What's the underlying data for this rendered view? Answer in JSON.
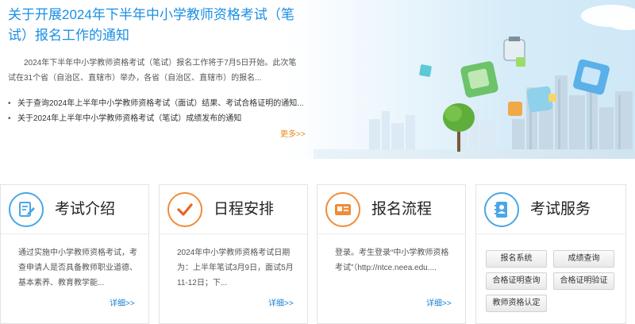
{
  "news": {
    "title": "关于开展2024年下半年中小学教师资格考试（笔试）报名工作的通知",
    "summary": "2024年下半年中小学教师资格考试（笔试）报名工作将于7月5日开始。此次笔试在31个省（自治区、直辖市）举办，各省（自治区、直辖市）的报名...",
    "items": [
      "关于查询2024年上半年中小学教师资格考试（面试）结果、考试合格证明的通知...",
      "关于2024年上半年中小学教师资格考试（笔试）成绩发布的通知"
    ],
    "bullet": "•",
    "more_label": "更多>>"
  },
  "cards": [
    {
      "title": "考试介绍",
      "text": "通过实施中小学教师资格考试，考查申请人是否具备教师职业道德、基本素养、教育教学能...",
      "detail_label": "详细>>",
      "icon": "document-edit-icon"
    },
    {
      "title": "日程安排",
      "text": "2024年中小学教师资格考试日期为：上半年笔试3月9日，面试5月11-12日；下...",
      "detail_label": "详细>>",
      "icon": "checkmark-icon"
    },
    {
      "title": "报名流程",
      "text": "登录。考生登录“中小学教师资格考试”（http://ntce.neea.edu....",
      "detail_label": "详细>>",
      "icon": "id-card-icon"
    },
    {
      "title": "考试服务",
      "icon": "address-book-icon",
      "buttons": [
        "报名系统",
        "成绩查询",
        "合格证明查询",
        "合格证明验证",
        "教师资格认定"
      ]
    }
  ],
  "colors": {
    "title_blue": "#1a8fe3",
    "more_orange": "#e88a1a",
    "detail_blue": "#1a7fd0",
    "icon_blue": "#4aa6e6",
    "icon_orange": "#f08c3a"
  }
}
